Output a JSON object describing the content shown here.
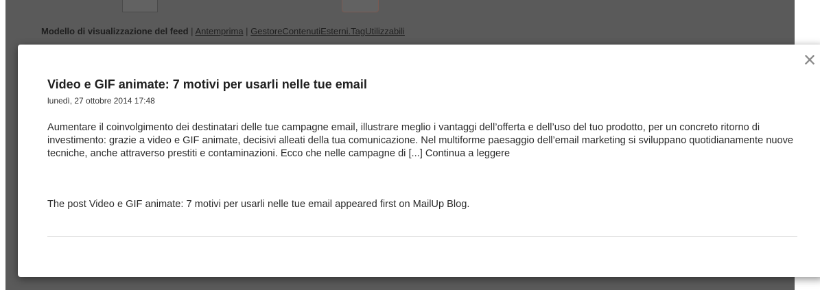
{
  "background": {
    "feed_template_label": "Modello di visualizzazione del feed",
    "separator": "|",
    "links": [
      "Antemprima",
      "GestoreContenutiEsterni.TagUtilizzabili"
    ]
  },
  "modal": {
    "close_symbol": "×",
    "post": {
      "title": "Video e GIF animate: 7 motivi per usarli nelle tue email",
      "date": "lunedì, 27 ottobre 2014 17:48",
      "excerpt": "Aumentare il coinvolgimento dei destinatari delle tue campagne email, illustrare meglio i vantaggi dell’offerta e dell’uso del tuo prodotto, per un concreto ritorno di investimento: grazie a video e GIF animate, decisivi alleati della tua comunicazione. Nel multiforme paesaggio dell’email marketing si sviluppano quotidianamente nuove tecniche, anche attraverso prestiti e contaminazioni. Ecco che nelle campagne di",
      "read_more": "[...] Continua a leggere",
      "footer": "The post Video e GIF animate: 7 motivi per usarli nelle tue email appeared first on MailUp Blog."
    }
  },
  "colors": {
    "overlay": "#5a5a5a",
    "modal_bg": "#ffffff",
    "text": "#2a2a2a",
    "close_icon": "#8a8a8a"
  }
}
